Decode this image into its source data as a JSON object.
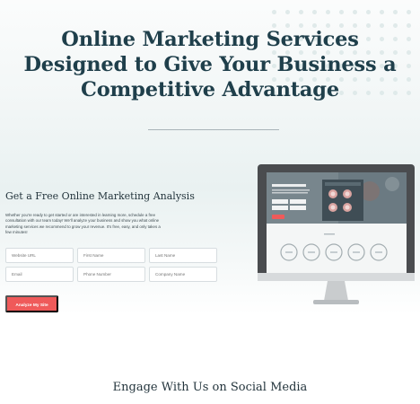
{
  "hero": {
    "line1": "Online Marketing Services",
    "line2": "Designed to Give Your Business a",
    "line3_lead": "Competitive ",
    "line3_bold": "Advantage"
  },
  "form": {
    "title": "Get a Free Online Marketing Analysis",
    "description": "Whether you're ready to get started or are interested in learning more, schedule a free consultation with our team today! We'll analyze your business and show you what online marketing services we recommend to grow your revenue. It's free, easy, and only takes a few minutes!",
    "fields": {
      "website_url": "Website URL",
      "first_name": "First Name",
      "last_name": "Last Name",
      "email": "Email",
      "phone": "Phone Number",
      "company": "Company Name"
    },
    "submit_label": "Analyze My Site"
  },
  "social": {
    "title": "Engage With Us on Social Media"
  },
  "colors": {
    "heading": "#1f3f4b",
    "accent": "#ef5a5a",
    "monitor_frame": "#4a4c4f"
  }
}
